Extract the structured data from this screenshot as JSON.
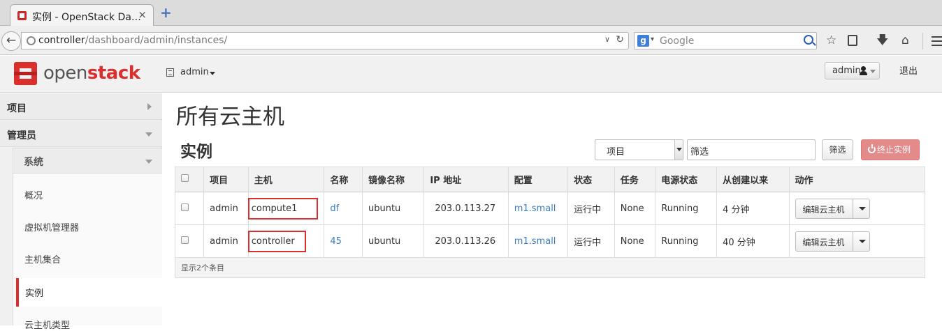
{
  "browser": {
    "tab_title": "实例 - OpenStack Da…",
    "tab_close": "×",
    "new_tab": "+",
    "url_host": "controller",
    "url_path": "/dashboard/admin/instances/",
    "search_placeholder": "Google",
    "search_engine_letter": "g"
  },
  "header": {
    "logo_open": "open",
    "logo_stack": "stack",
    "project": "admin",
    "user": "admin",
    "logout": "退出"
  },
  "sidebar": {
    "project_panel": "项目",
    "admin_panel": "管理员",
    "system_group": "系统",
    "items": [
      "概况",
      "虚拟机管理器",
      "主机集合",
      "实例",
      "云主机类型"
    ],
    "active_item": "实例"
  },
  "main": {
    "page_title": "所有云主机",
    "section_title": "实例",
    "filter_select": "项目",
    "filter_input_value": "筛选",
    "filter_button": "筛选",
    "terminate_button": "终止实例"
  },
  "table": {
    "columns": [
      "项目",
      "主机",
      "名称",
      "镜像名称",
      "IP 地址",
      "配置",
      "状态",
      "任务",
      "电源状态",
      "从创建以来",
      "动作"
    ],
    "rows": [
      {
        "project": "admin",
        "host": "compute1",
        "name": "df",
        "image": "ubuntu",
        "ip": "203.0.113.27",
        "flavor": "m1.small",
        "status": "运行中",
        "task": "None",
        "power": "Running",
        "age": "4 分钟",
        "action": "编辑云主机"
      },
      {
        "project": "admin",
        "host": "controller",
        "name": "45",
        "image": "ubuntu",
        "ip": "203.0.113.26",
        "flavor": "m1.small",
        "status": "运行中",
        "task": "None",
        "power": "Running",
        "age": "40 分钟",
        "action": "编辑云主机"
      }
    ],
    "footer": "显示2个条目"
  },
  "colors": {
    "accent_red": "#d9302d",
    "link_blue": "#3a7dbd",
    "terminate_bg": "#e38b8b"
  }
}
